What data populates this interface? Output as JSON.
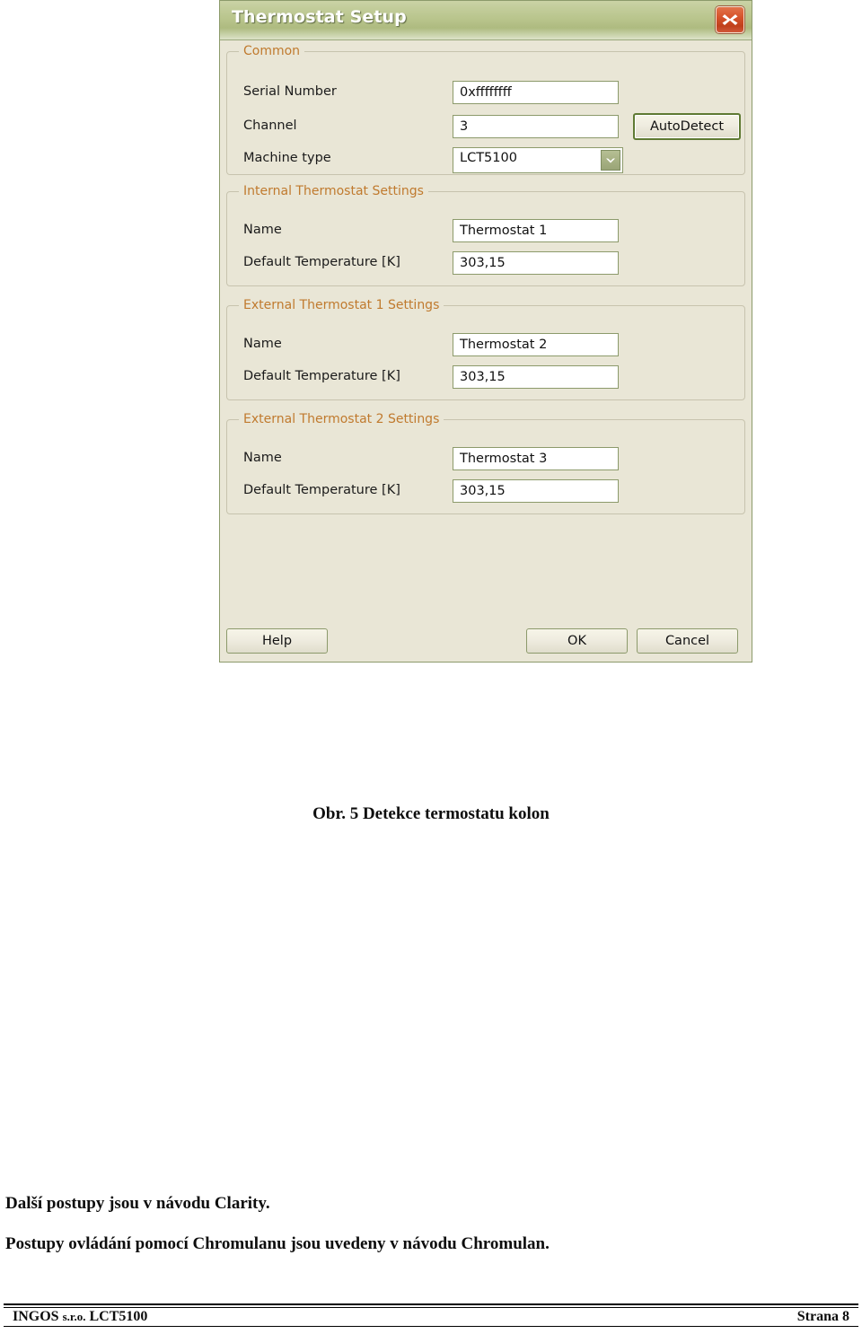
{
  "document": {
    "figure_caption": "Obr. 5 Detekce termostatu kolon",
    "paragraphs": [
      "Další postupy jsou v návodu Clarity.",
      "Postupy ovládání pomocí Chromulanu jsou uvedeny v návodu Chromulan."
    ],
    "footer": {
      "left_primary": "INGOS",
      "left_small": "s.r.o.",
      "left_secondary": "LCT5100",
      "right": "Strana 8"
    }
  },
  "dialog": {
    "title": "Thermostat Setup",
    "close_icon": "close-icon",
    "groups": [
      {
        "legend": "Common",
        "fields": [
          {
            "label": "Serial Number",
            "value": "0xffffffff",
            "type": "text"
          },
          {
            "label": "Channel",
            "value": "3",
            "type": "text"
          },
          {
            "label": "Machine type",
            "value": "LCT5100",
            "type": "combo",
            "options": [
              "LCT5100"
            ]
          }
        ],
        "side_button": "AutoDetect"
      },
      {
        "legend": "Internal Thermostat Settings",
        "fields": [
          {
            "label": "Name",
            "value": "Thermostat 1",
            "type": "text"
          },
          {
            "label": "Default Temperature [K]",
            "value": "303,15",
            "type": "text"
          }
        ]
      },
      {
        "legend": "External Thermostat 1 Settings",
        "fields": [
          {
            "label": "Name",
            "value": "Thermostat 2",
            "type": "text"
          },
          {
            "label": "Default Temperature [K]",
            "value": "303,15",
            "type": "text"
          }
        ]
      },
      {
        "legend": "External Thermostat 2 Settings",
        "fields": [
          {
            "label": "Name",
            "value": "Thermostat 3",
            "type": "text"
          },
          {
            "label": "Default Temperature [K]",
            "value": "303,15",
            "type": "text"
          }
        ]
      }
    ],
    "buttons": {
      "help": "Help",
      "ok": "OK",
      "cancel": "Cancel"
    },
    "colors": {
      "titlebar_green": "#b9c58d",
      "legend_orange": "#c07a2e",
      "close_red": "#d6532b",
      "client_bg": "#e9e6d6",
      "field_border": "#8c9a6b",
      "focus_border": "#5f7a33"
    }
  }
}
